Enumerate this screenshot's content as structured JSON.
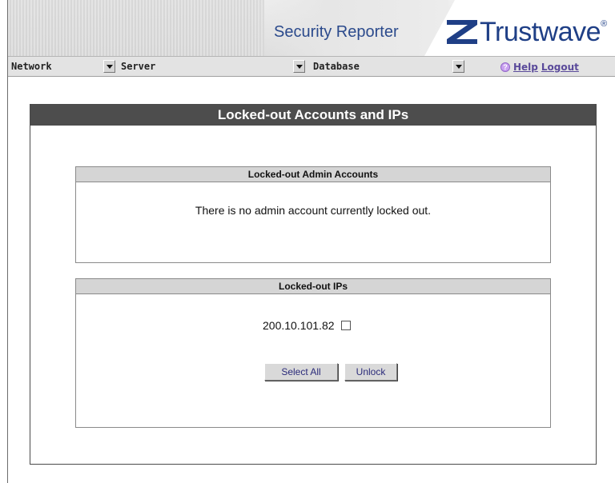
{
  "header": {
    "app_title": "Security Reporter",
    "brand": "Trustwave",
    "brand_mark": "®",
    "brand_color": "#1f3f86",
    "logo_icon": "trustwave-z-logo-icon"
  },
  "nav": {
    "network_label": "Network",
    "server_label": "Server",
    "database_label": "Database",
    "help_label": "Help",
    "logout_label": "Logout",
    "help_icon": "question-circle-icon"
  },
  "panel": {
    "title": "Locked-out Accounts and IPs"
  },
  "admin_accounts": {
    "header": "Locked-out Admin Accounts",
    "message": "There is no admin account currently locked out."
  },
  "ips": {
    "header": "Locked-out IPs",
    "items": [
      {
        "ip": "200.10.101.82",
        "checked": false
      }
    ],
    "select_all_label": "Select All",
    "unlock_label": "Unlock"
  }
}
